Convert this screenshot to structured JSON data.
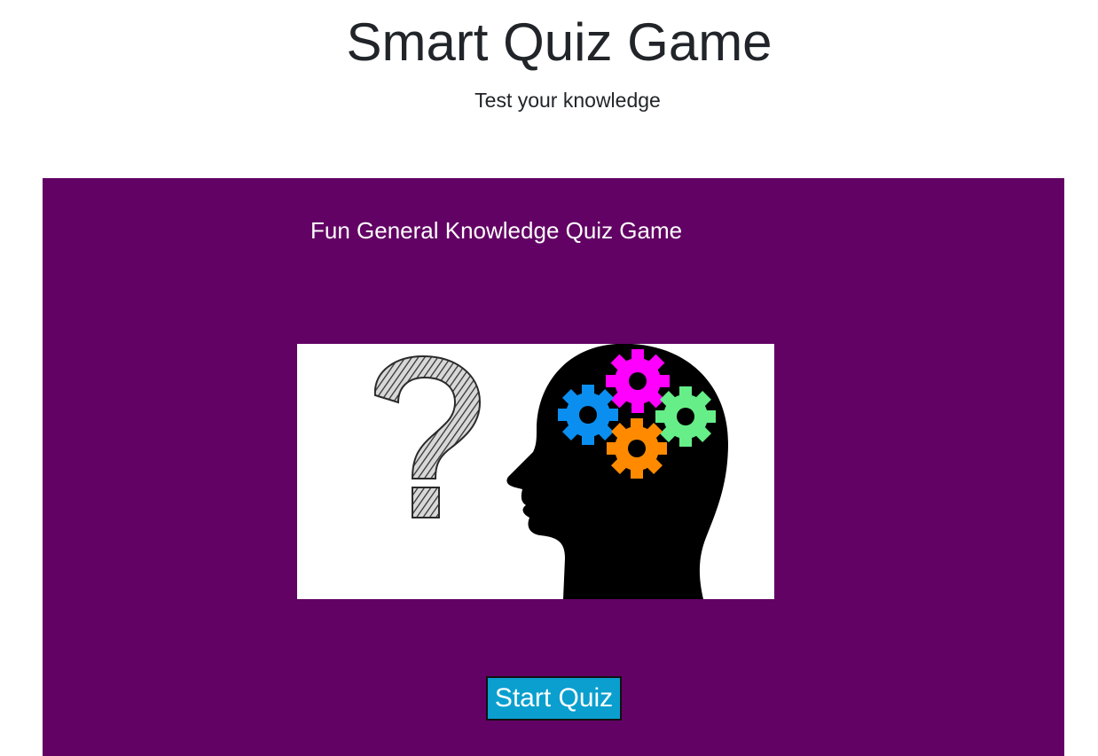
{
  "header": {
    "title": "Smart Quiz Game",
    "subtitle": "Test your knowledge"
  },
  "panel": {
    "heading": "Fun General Knowledge Quiz Game",
    "background_color": "#620264",
    "image": {
      "description_icon": "question-mark-and-head-with-gears-icon",
      "gear_colors": [
        "#ff00ff",
        "#0a8ff0",
        "#66ee88",
        "#ff8a00"
      ]
    },
    "start_button_label": "Start Quiz",
    "start_button_color": "#0a9fcf"
  }
}
